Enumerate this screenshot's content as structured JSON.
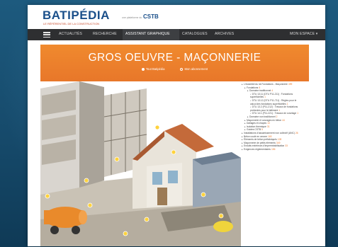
{
  "header": {
    "logo": "BATIPÉDIA",
    "logo_sub": "LE RÉFÉRENTIEL DE LA CONSTRUCTION",
    "partner_prefix": "une plateforme du",
    "partner": "CSTB"
  },
  "nav": {
    "items": [
      {
        "label": "ACTUALITÉS"
      },
      {
        "label": "RECHERCHE"
      },
      {
        "label": "ASSISTANT GRAPHIQUE"
      },
      {
        "label": "CATALOGUES"
      },
      {
        "label": "ARCHIVES"
      }
    ],
    "account": "MON ESPACE ▾"
  },
  "banner": {
    "title": "GROS OEUVRE - MAÇONNERIE",
    "option_all": "Tout Batipédia",
    "option_mine": "Mon abonnement"
  },
  "tree": [
    {
      "level": 0,
      "label": "L'essentiel du lot Fondations - Maçonnerie",
      "count": "499"
    },
    {
      "level": 1,
      "label": "Fondations",
      "count": "6"
    },
    {
      "level": 2,
      "label": "Domaine traditionnel",
      "count": "4"
    },
    {
      "level": 3,
      "label": "DTU 13.11 (DTU P11-211) : Fondations superficielles",
      "count": "1"
    },
    {
      "level": 3,
      "label": "DTU 13.12 (DTU P11-711) : Règles pour le calcul des fondations superficielles",
      "count": "1"
    },
    {
      "level": 3,
      "label": "DTU 13.2 (P11-212) : Travaux de fondations profondes pour le bâtiment",
      "count": "1"
    },
    {
      "level": 3,
      "label": "DTU 14.1 (P11-221) : Travaux de cuvelage",
      "count": "1"
    },
    {
      "level": 2,
      "label": "Domaine non traditionnel",
      "count": "2"
    },
    {
      "level": 1,
      "label": "Maçonnerie et ouvrages en béton",
      "count": "44"
    },
    {
      "level": 1,
      "label": "Dallages et chapes",
      "count": "13"
    },
    {
      "level": 1,
      "label": "Isolation thermique",
      "count": "31"
    },
    {
      "level": 1,
      "label": "Guides CSTB",
      "count": "5"
    },
    {
      "level": 0,
      "label": "Installations d'assainissement non collectif (ANC)",
      "count": "26"
    },
    {
      "level": 0,
      "label": "Béton coulé en oeuvre",
      "count": "163"
    },
    {
      "level": 0,
      "label": "Éléments de béton préfabriqués",
      "count": "128"
    },
    {
      "level": 0,
      "label": "Maçonnerie de petits éléments",
      "count": "349"
    },
    {
      "level": 0,
      "label": "Enduits extérieurs d'imperméabilisation",
      "count": "33"
    },
    {
      "level": 0,
      "label": "Exigences réglementaires",
      "count": "156"
    }
  ],
  "colors": {
    "brand_blue": "#1a4f8a",
    "orange": "#e8772a",
    "nav_bg": "#2e2f31"
  }
}
